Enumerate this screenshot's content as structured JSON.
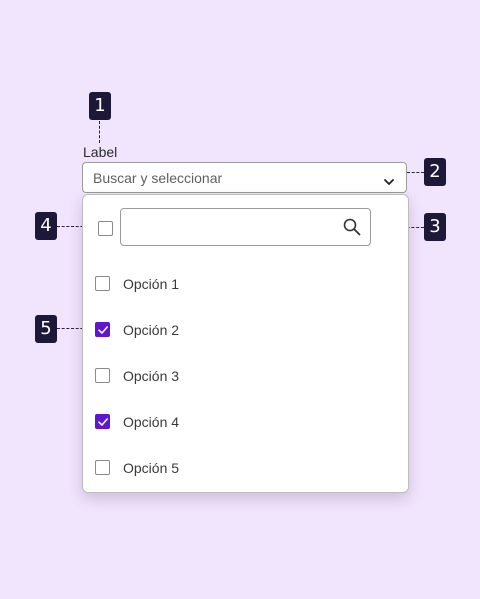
{
  "annotations": [
    "1",
    "2",
    "3",
    "4",
    "5"
  ],
  "field": {
    "label": "Label",
    "placeholder": "Buscar y seleccionar"
  },
  "search": {
    "value": "",
    "placeholder": ""
  },
  "select_all": {
    "checked": false
  },
  "options": [
    {
      "label": "Opción 1",
      "checked": false
    },
    {
      "label": "Opción 2",
      "checked": true
    },
    {
      "label": "Opción 3",
      "checked": false
    },
    {
      "label": "Opción 4",
      "checked": true
    },
    {
      "label": "Opción 5",
      "checked": false
    }
  ],
  "colors": {
    "background": "#f1e4fd",
    "accent": "#6015d1",
    "badge": "#1e1838"
  },
  "icons": {
    "chevron": "chevron-down-icon",
    "search": "search-icon",
    "check": "check-icon"
  }
}
